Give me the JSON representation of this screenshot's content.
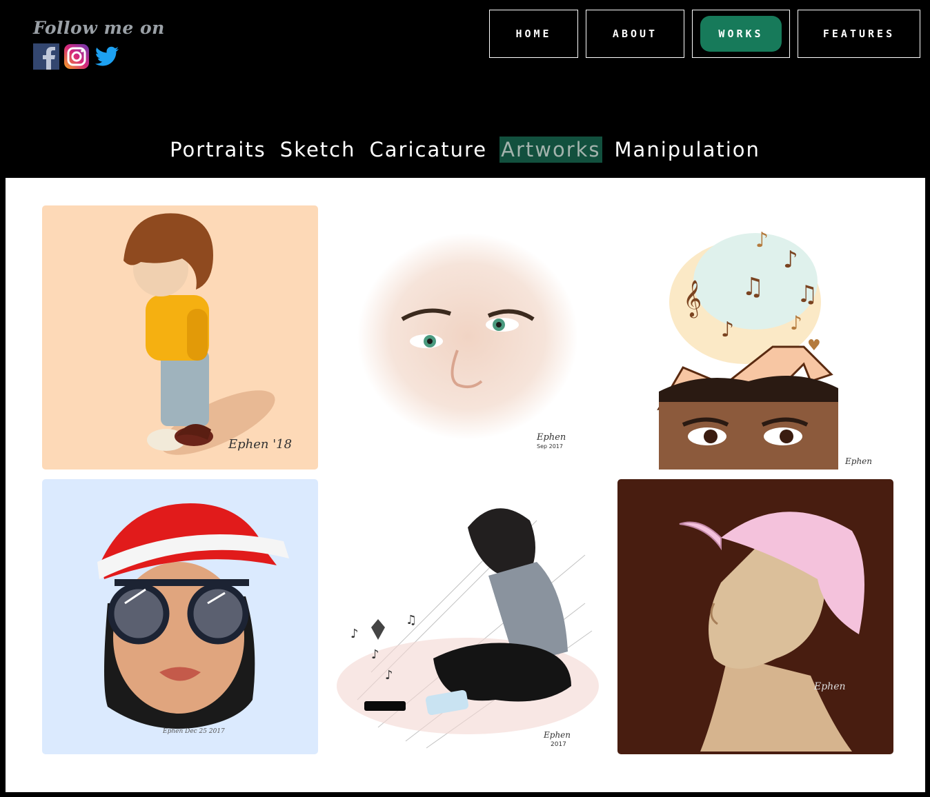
{
  "header": {
    "follow_text": "Follow me on",
    "socials": [
      {
        "name": "facebook-icon",
        "color": "#3b5998"
      },
      {
        "name": "instagram-icon",
        "color": "#c13584"
      },
      {
        "name": "twitter-icon",
        "color": "#1da1f2"
      }
    ]
  },
  "nav": {
    "items": [
      {
        "label": "HOME",
        "active": false
      },
      {
        "label": "ABOUT",
        "active": false
      },
      {
        "label": "WORKS",
        "active": true
      },
      {
        "label": "FEATURES",
        "active": false
      }
    ],
    "accent": "#177a5a"
  },
  "tabs": {
    "items": [
      {
        "label": "Portraits",
        "active": false
      },
      {
        "label": "Sketch",
        "active": false
      },
      {
        "label": "Caricature",
        "active": false
      },
      {
        "label": "Artworks",
        "active": true
      },
      {
        "label": "Manipulation",
        "active": false
      }
    ],
    "active_bg": "#12503e"
  },
  "gallery": {
    "items": [
      {
        "name": "artwork-boy-yellow-hoodie",
        "bg": "#fdd9b7",
        "signature": "Ephen '18"
      },
      {
        "name": "artwork-watercolor-face",
        "bg": "#ffffff",
        "signature": "Ephen Sep 2017"
      },
      {
        "name": "artwork-music-head",
        "bg": "#ffffff",
        "signature": "Ephen"
      },
      {
        "name": "artwork-santa-hat-girl",
        "bg": "#dbeafe",
        "signature": "Ephen Dec 25 2017"
      },
      {
        "name": "artwork-sad-sitting-boy",
        "bg": "#ffffff",
        "signature": "Ephen 2017"
      },
      {
        "name": "artwork-pink-cap-profile",
        "bg": "#481d10",
        "signature": "Ephen"
      }
    ]
  }
}
